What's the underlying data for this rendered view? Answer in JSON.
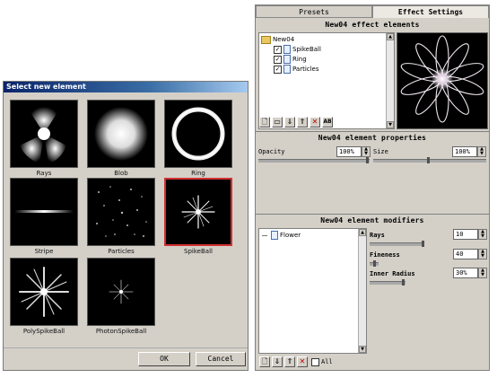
{
  "dialog": {
    "title": "Select new element",
    "tiles": [
      {
        "label": "Rays",
        "icon": "rays-thumbnail-icon"
      },
      {
        "label": "Blob",
        "icon": "blob-thumbnail-icon"
      },
      {
        "label": "Ring",
        "icon": "ring-thumbnail-icon"
      },
      {
        "label": "Stripe",
        "icon": "stripe-thumbnail-icon"
      },
      {
        "label": "Particles",
        "icon": "particles-thumbnail-icon"
      },
      {
        "label": "SpikeBall",
        "icon": "spikeball-thumbnail-icon"
      },
      {
        "label": "PolySpikeBall",
        "icon": "polyspikeball-thumbnail-icon"
      },
      {
        "label": "PhotonSpikeBall",
        "icon": "photonspikeball-thumbnail-icon"
      }
    ],
    "selected_tile": "SpikeBall",
    "ok_label": "OK",
    "cancel_label": "Cancel",
    "selection_color": "#d03030"
  },
  "panel": {
    "tabs": [
      {
        "label": "Presets",
        "active": false
      },
      {
        "label": "Effect Settings",
        "active": true
      }
    ],
    "elements": {
      "title": "New04 effect elements",
      "root": "New04",
      "items": [
        {
          "label": "SpikeBall",
          "checked": true
        },
        {
          "label": "Ring",
          "checked": true
        },
        {
          "label": "Particles",
          "checked": true
        }
      ],
      "toolbar_icons": [
        "new-icon",
        "open-icon",
        "move-down-icon",
        "move-up-icon",
        "delete-icon",
        "rename-icon"
      ],
      "rename_glyph": "AB"
    },
    "properties": {
      "title": "New04 element properties",
      "opacity_label": "Opacity",
      "opacity_value": "100%",
      "size_label": "Size",
      "size_value": "100%"
    },
    "modifiers": {
      "title": "New04 element modifiers",
      "items": [
        {
          "label": "Flower"
        }
      ],
      "rays_label": "Rays",
      "rays_value": "10",
      "fineness_label": "Fineness",
      "fineness_value": "40",
      "inner_radius_label": "Inner Radius",
      "inner_radius_value": "30%",
      "all_label": "All",
      "toolbar_icons": [
        "new-icon",
        "move-down-icon",
        "move-up-icon",
        "delete-icon"
      ]
    }
  }
}
